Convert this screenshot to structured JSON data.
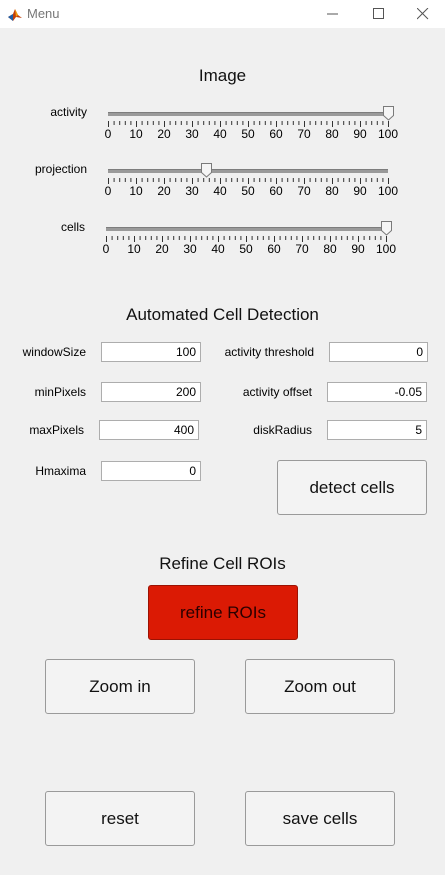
{
  "window": {
    "title": "Menu"
  },
  "image_section": {
    "heading": "Image",
    "sliders": [
      {
        "label": "activity",
        "value": 100,
        "min": 0,
        "max": 100
      },
      {
        "label": "projection",
        "value": 35,
        "min": 0,
        "max": 100
      },
      {
        "label": "cells",
        "value": 100,
        "min": 0,
        "max": 100
      }
    ],
    "tick_labels": [
      "0",
      "10",
      "20",
      "30",
      "40",
      "50",
      "60",
      "70",
      "80",
      "90",
      "100"
    ]
  },
  "detection": {
    "heading": "Automated Cell Detection",
    "fields": {
      "windowSize": {
        "label": "windowSize",
        "value": "100"
      },
      "activity_threshold": {
        "label": "activity threshold",
        "value": "0"
      },
      "minPixels": {
        "label": "minPixels",
        "value": "200"
      },
      "activity_offset": {
        "label": "activity offset",
        "value": "-0.05"
      },
      "maxPixels": {
        "label": "maxPixels",
        "value": "400"
      },
      "diskRadius": {
        "label": "diskRadius",
        "value": "5"
      },
      "Hmaxima": {
        "label": "Hmaxima",
        "value": "0"
      }
    },
    "detect_button": "detect cells"
  },
  "refine": {
    "heading": "Refine Cell ROIs",
    "refine_button": "refine ROIs",
    "refine_button_color": "#db1a04",
    "zoom_in_button": "Zoom in",
    "zoom_out_button": "Zoom out"
  },
  "footer": {
    "reset_button": "reset",
    "save_button": "save cells"
  }
}
